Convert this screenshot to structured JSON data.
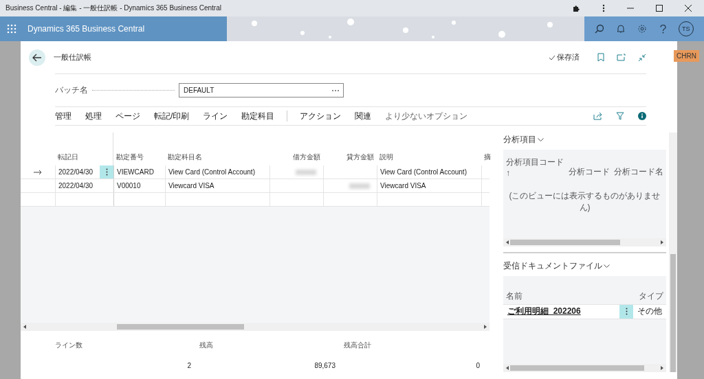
{
  "window": {
    "title": "Business Central - 編集 - 一般仕訳帳 - Dynamics 365 Business Central"
  },
  "app_bar": {
    "product": "Dynamics 365 Business Central",
    "avatar": "TS"
  },
  "badge": "CHRN",
  "page": {
    "title": "一般仕訳帳",
    "status": "保存済"
  },
  "batch": {
    "label": "バッチ名",
    "value": "DEFAULT"
  },
  "actions_primary": [
    "管理",
    "処理",
    "ページ",
    "転記/印刷",
    "ライン",
    "勘定科目"
  ],
  "actions_secondary": [
    "アクション",
    "関連"
  ],
  "options_toggle": "より少ないオプション",
  "grid": {
    "columns": [
      "転記日",
      "勘定番号",
      "勘定科目名",
      "借方金額",
      "貸方金額",
      "説明",
      "摘"
    ],
    "rows": [
      {
        "selected": true,
        "posting_date": "2022/04/30",
        "account_no": "VIEWCARD",
        "account_name": "View Card (Control Account)",
        "debit_blurred": true,
        "credit_blurred": false,
        "description": "View Card (Control Account)"
      },
      {
        "selected": false,
        "posting_date": "2022/04/30",
        "account_no": "V00010",
        "account_name": "Viewcard VISA",
        "debit_blurred": false,
        "credit_blurred": true,
        "description": "Viewcard VISA"
      }
    ]
  },
  "footer": [
    {
      "label": "ライン数",
      "value": "2"
    },
    {
      "label": "残高",
      "value": "89,673"
    },
    {
      "label": "残高合計",
      "value": "0"
    }
  ],
  "factboxes": [
    {
      "title": "分析項目",
      "columns": [
        "分析項目コード↑",
        "分析コード",
        "分析コード名"
      ],
      "empty_message": "(このビューには表示するものがありません)"
    },
    {
      "title": "受信ドキュメントファイル",
      "columns": [
        "名前",
        "タイプ"
      ],
      "rows": [
        {
          "name": "ご利用明細_202206",
          "type": "その他"
        }
      ]
    }
  ]
}
